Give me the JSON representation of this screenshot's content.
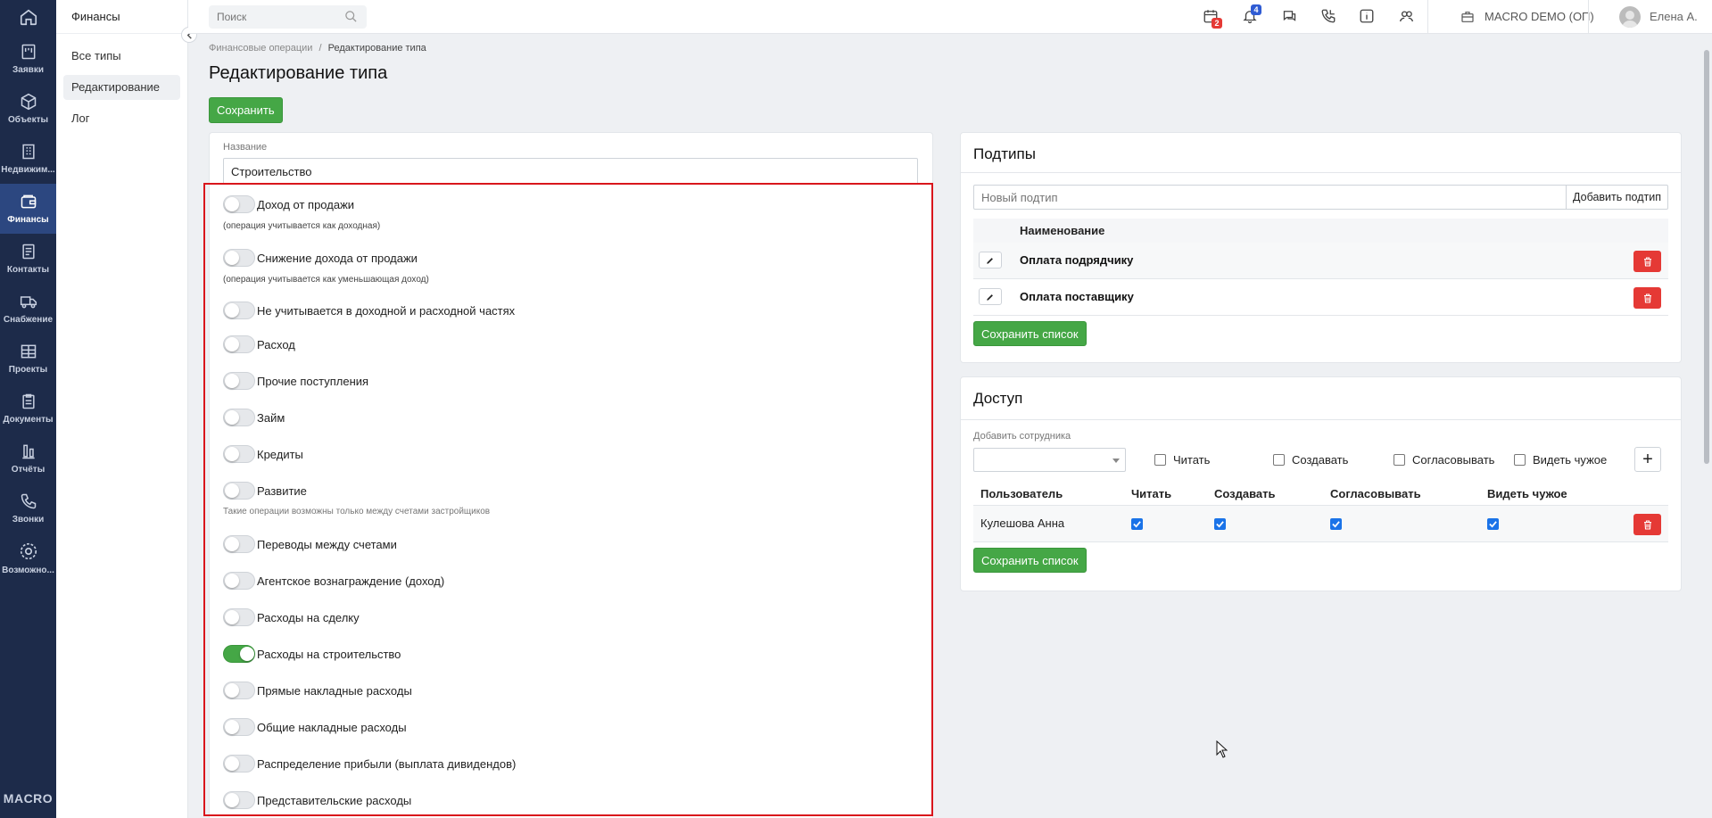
{
  "rail": {
    "items": [
      {
        "label": "Заявки",
        "icon": "requests-icon"
      },
      {
        "label": "Объекты",
        "icon": "cube-icon"
      },
      {
        "label": "Недвижим...",
        "icon": "building-icon"
      },
      {
        "label": "Финансы",
        "icon": "wallet-icon",
        "active": true
      },
      {
        "label": "Контакты",
        "icon": "contacts-icon"
      },
      {
        "label": "Снабжение",
        "icon": "truck-icon"
      },
      {
        "label": "Проекты",
        "icon": "projects-icon"
      },
      {
        "label": "Документы",
        "icon": "clipboard-icon"
      },
      {
        "label": "Отчёты",
        "icon": "bar-chart-icon"
      },
      {
        "label": "Звонки",
        "icon": "phone-icon"
      },
      {
        "label": "Возможно...",
        "icon": "gear-icon"
      }
    ],
    "brand": "MACRO"
  },
  "sidebar": {
    "title": "Финансы",
    "items": [
      {
        "label": "Все типы"
      },
      {
        "label": "Редактирование",
        "selected": true
      },
      {
        "label": "Лог"
      }
    ]
  },
  "topbar": {
    "search_placeholder": "Поиск",
    "calendar_badge": "2",
    "bell_badge": "4",
    "company": "MACRO DEMO (ОП)",
    "user": "Елена А."
  },
  "breadcrumb": {
    "parent": "Финансовые операции",
    "separator": "/",
    "current": "Редактирование типа"
  },
  "page": {
    "title": "Редактирование типа",
    "save_label": "Сохранить"
  },
  "form": {
    "name_label": "Название",
    "name_value": "Строительство",
    "toggles": [
      {
        "label": "Доход от продажи",
        "on": false,
        "hint": "(операция учитывается как доходная)"
      },
      {
        "label": "Снижение дохода от продажи",
        "on": false,
        "hint": "(операция учитывается как уменьшающая доход)"
      },
      {
        "label": "Не учитывается в доходной и расходной частях",
        "on": false
      },
      {
        "label": "Расход",
        "on": false
      },
      {
        "label": "Прочие поступления",
        "on": false
      },
      {
        "label": "Займ",
        "on": false
      },
      {
        "label": "Кредиты",
        "on": false
      },
      {
        "label": "Развитие",
        "on": false,
        "hint": "Такие операции возможны только между счетами застройщиков"
      },
      {
        "label": "Переводы между счетами",
        "on": false
      },
      {
        "label": "Агентское вознаграждение (доход)",
        "on": false
      },
      {
        "label": "Расходы на сделку",
        "on": false
      },
      {
        "label": "Расходы на строительство",
        "on": true
      },
      {
        "label": "Прямые накладные расходы",
        "on": false
      },
      {
        "label": "Общие накладные расходы",
        "on": false
      },
      {
        "label": "Распределение прибыли (выплата дивидендов)",
        "on": false
      },
      {
        "label": "Представительские расходы",
        "on": false
      }
    ]
  },
  "subtypes": {
    "title": "Подтипы",
    "new_placeholder": "Новый подтип",
    "add_label": "Добавить подтип",
    "column": "Наименование",
    "rows": [
      {
        "name": "Оплата подрядчику"
      },
      {
        "name": "Оплата поставщику"
      }
    ],
    "save_list_label": "Сохранить список"
  },
  "access": {
    "title": "Доступ",
    "add_employee_label": "Добавить сотрудника",
    "checks": [
      "Читать",
      "Создавать",
      "Согласовывать",
      "Видеть чужое"
    ],
    "columns": [
      "Пользователь",
      "Читать",
      "Создавать",
      "Согласовывать",
      "Видеть чужое"
    ],
    "rows": [
      {
        "user": "Кулешова Анна",
        "read": true,
        "create": true,
        "approve": true,
        "see_others": true
      }
    ],
    "save_list_label": "Сохранить список"
  },
  "colors": {
    "rail_bg": "#1d2b4a",
    "rail_active": "#2c4780",
    "green": "#45a746",
    "red": "#e53935",
    "highlight": "#d9161c"
  }
}
